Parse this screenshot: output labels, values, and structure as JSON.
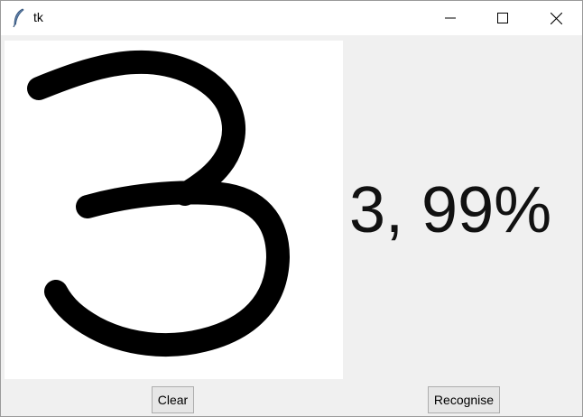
{
  "window": {
    "title": "tk",
    "controls": [
      "minimize-icon",
      "maximize-icon",
      "close-icon"
    ]
  },
  "canvas": {
    "drawn_digit": "3",
    "background_color": "#ffffff",
    "stroke_color": "#000000"
  },
  "result": {
    "text": "3, 99%"
  },
  "buttons": {
    "clear_label": "Clear",
    "recognise_label": "Recognise"
  },
  "colors": {
    "window_background": "#f0f0f0",
    "titlebar_background": "#ffffff"
  }
}
